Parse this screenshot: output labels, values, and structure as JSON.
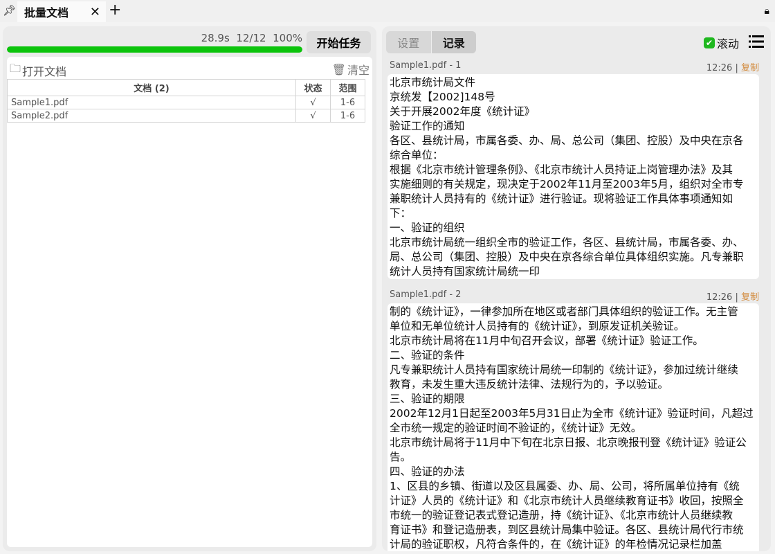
{
  "tabbar": {
    "tab_title": "批量文档",
    "close": "✕",
    "add": "+",
    "pin": "⚲"
  },
  "left": {
    "progress": {
      "elapsed": "28.9s",
      "count": "12/12",
      "percent_text": "100%",
      "percent": 100
    },
    "start_button": "开始任务",
    "open_label": "打开文档",
    "clear_label": "清空",
    "table": {
      "headers": [
        "文档 (2)",
        "状态",
        "范围"
      ],
      "rows": [
        [
          "Sample1.pdf",
          "√",
          "1-6"
        ],
        [
          "Sample2.pdf",
          "√",
          "1-6"
        ]
      ]
    }
  },
  "right": {
    "tabs": [
      "设置",
      "记录"
    ],
    "scroll_label": "滚动",
    "records": [
      {
        "title": "Sample1.pdf - 1",
        "time": "12:26",
        "sep": "|",
        "copy": "复制",
        "lines": [
          "北京市统计局文件",
          "京统发【2002]148号",
          "关于开展2002年度《统计证》",
          "验证工作的通知",
          "各区、县统计局，市属各委、办、局、总公司（集团、控股）及中央在京各",
          "综合单位：",
          "根据《北京市统计管理条例》、《北京市统计人员持证上岗管理办法》及其",
          "实施细则的有关规定，现决定于2002年11月至2003年5月，组织对全市专",
          "兼职统计人员持有的《统计证》进行验证。现将验证工作具体事项通知如",
          "下：",
          "一、验证的组织",
          "北京市统计局统一组织全市的验证工作，各区、县统计局，市属各委、办、",
          "局、总公司（集团、控股）及中央在京各综合单位具体组织实施。凡专兼职",
          "统计人员持有国家统计局统一印"
        ]
      },
      {
        "title": "Sample1.pdf - 2",
        "time": "12:26",
        "sep": "|",
        "copy": "复制",
        "lines": [
          "制的《统计证》，一律参加所在地区或者部门具体组织的验证工作。无主管",
          "单位和无单位统计人员持有的《统计证》，到原发证机关验证。",
          "北京市统计局将在11月中旬召开会议，部署《统计证》验证工作。",
          "二、验证的条件",
          "凡专兼职统计人员持有国家统计局统一印制的《统计证》，参加过统计继续",
          "教育，未发生重大违反统计法律、法规行为的，予以验证。",
          "三、验证的期限",
          "2002年12月1日起至2003年5月31日止为全市《统计证》验证时间，凡超过",
          "全市统一规定的验证时间不验证的，《统计证》无效。",
          "北京市统计局将于11月中下旬在北京日报、北京晚报刊登《统计证》验证公",
          "告。",
          "四、验证的办法",
          "1、区县的乡镇、街道以及区县属委、办、局、公司，将所属单位持有《统",
          "计证》人员的《统计证》和《北京市统计人员继续教育证书》收回，按照全",
          "市统一的验证登记表式登记造册，持《统计证》、《北京市统计人员继续教",
          "育证书》和登记造册表，到区县统计局集中验证。各区、县统计局代行市统",
          "计局的验证职权，凡符合条件的，在《统计证》的年检情况记录栏加盖"
        ]
      }
    ]
  }
}
